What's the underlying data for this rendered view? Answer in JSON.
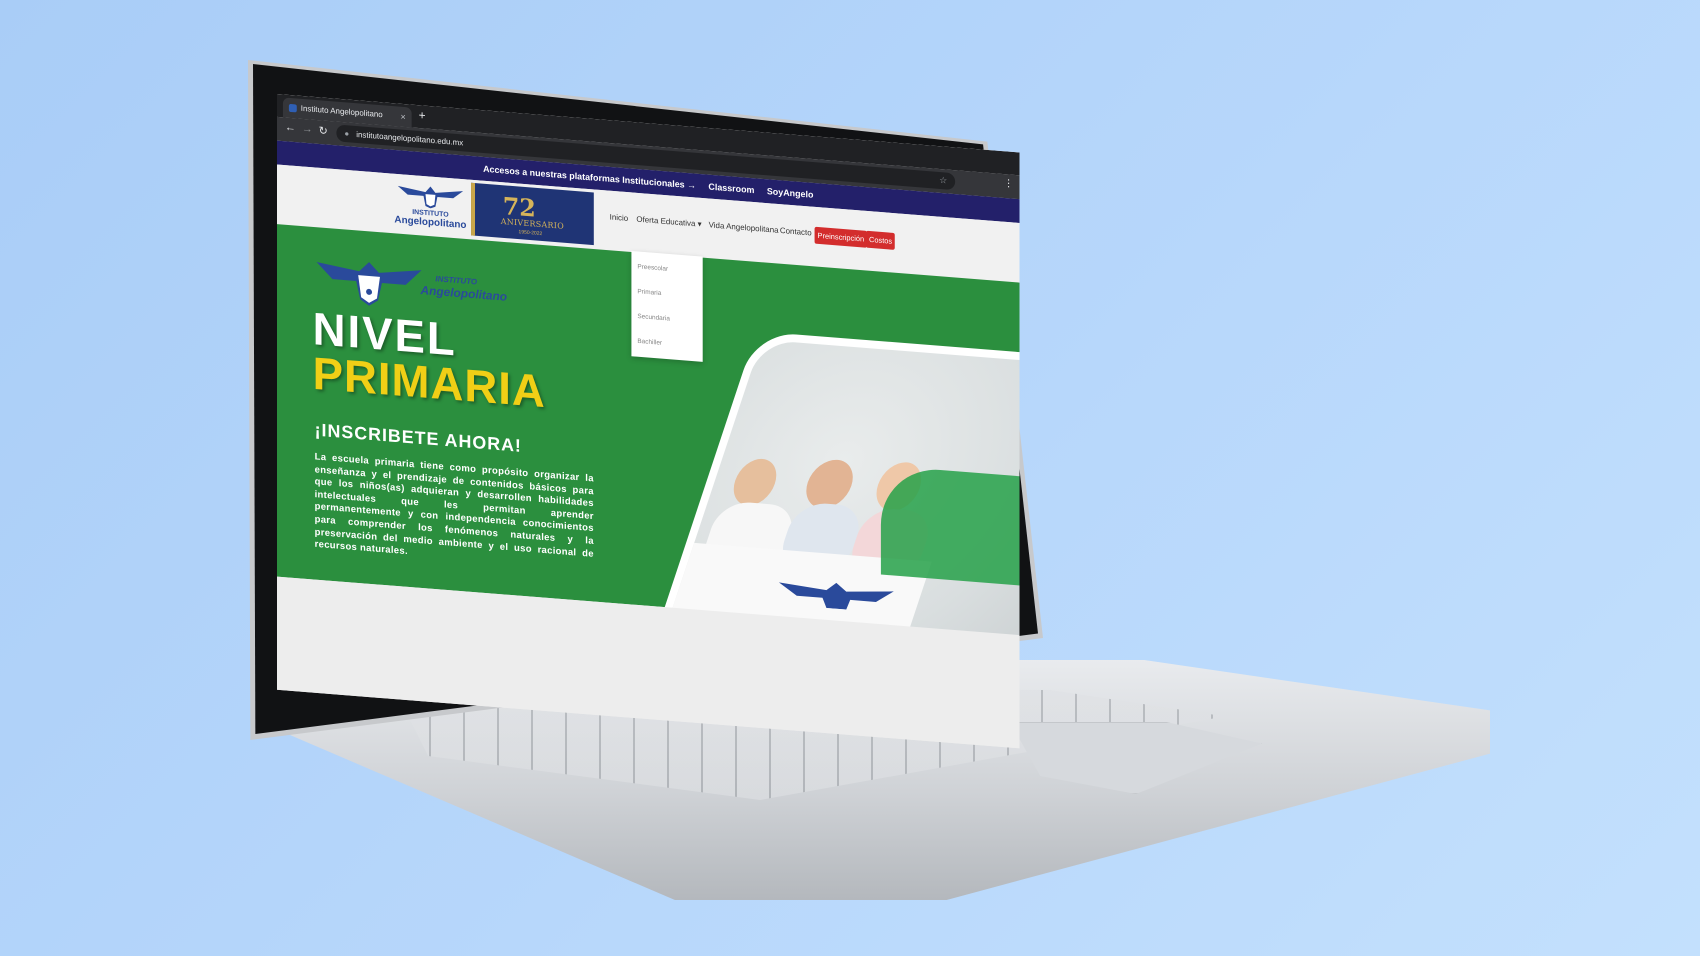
{
  "browser": {
    "tab_title": "Instituto Angelopolitano",
    "tab_close": "×",
    "new_tab": "+",
    "url": "institutoangelopolitano.edu.mx",
    "back": "←",
    "forward": "→",
    "reload": "↻",
    "star": "☆",
    "menu": "⋮",
    "lock": "🔒"
  },
  "topbar": {
    "text": "Accesos a nuestras plataformas Institucionales →",
    "links": [
      "Classroom",
      "SoyAngelo"
    ]
  },
  "header": {
    "logo_small": "INSTITUTO",
    "logo_name": "Angelopolitano",
    "anniversary": {
      "number": "72",
      "label": "ANIVERSARIO",
      "years": "1950-2022"
    },
    "nav": {
      "inicio": "Inicio",
      "oferta": "Oferta Educativa",
      "vida": "Vida Angelopolitana",
      "contacto": "Contacto",
      "preinscripcion": "Preinscripción",
      "costos": "Costos"
    },
    "dropdown": [
      "Preescolar",
      "Primaria",
      "Secundaria",
      "Bachiller"
    ]
  },
  "hero": {
    "logo_small": "INSTITUTO",
    "logo_name": "Angelopolitano",
    "title_line1": "NIVEL",
    "title_line2": "PRIMARIA",
    "cta": "¡INSCRIBETE AHORA!",
    "description": "La escuela primaria tiene como propósito organizar la enseñanza y el prendizaje de contenidos básicos para que los niños(as) adquieran y desarrollen habilidades intelectuales que les permitan aprender permanentemente y con independencia conocimientos para comprender los fenómenos naturales y la preservación del medio ambiente y el uso racional de recursos naturales."
  },
  "colors": {
    "background": "#b7d7fb",
    "topbar": "#23206a",
    "hero_green": "#2b8f3e",
    "accent_yellow": "#f0cf16",
    "button_red": "#d32d2d",
    "logo_blue": "#2a4a9b"
  }
}
